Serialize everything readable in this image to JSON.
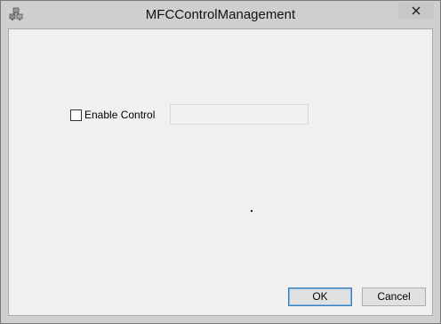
{
  "window": {
    "title": "MFCControlManagement",
    "icon": "mfc-app-icon",
    "close_icon": "close-icon"
  },
  "dialog": {
    "checkbox": {
      "label": "Enable Control",
      "checked": false
    },
    "edit": {
      "value": "",
      "enabled": false
    },
    "buttons": {
      "ok": "OK",
      "cancel": "Cancel"
    }
  }
}
